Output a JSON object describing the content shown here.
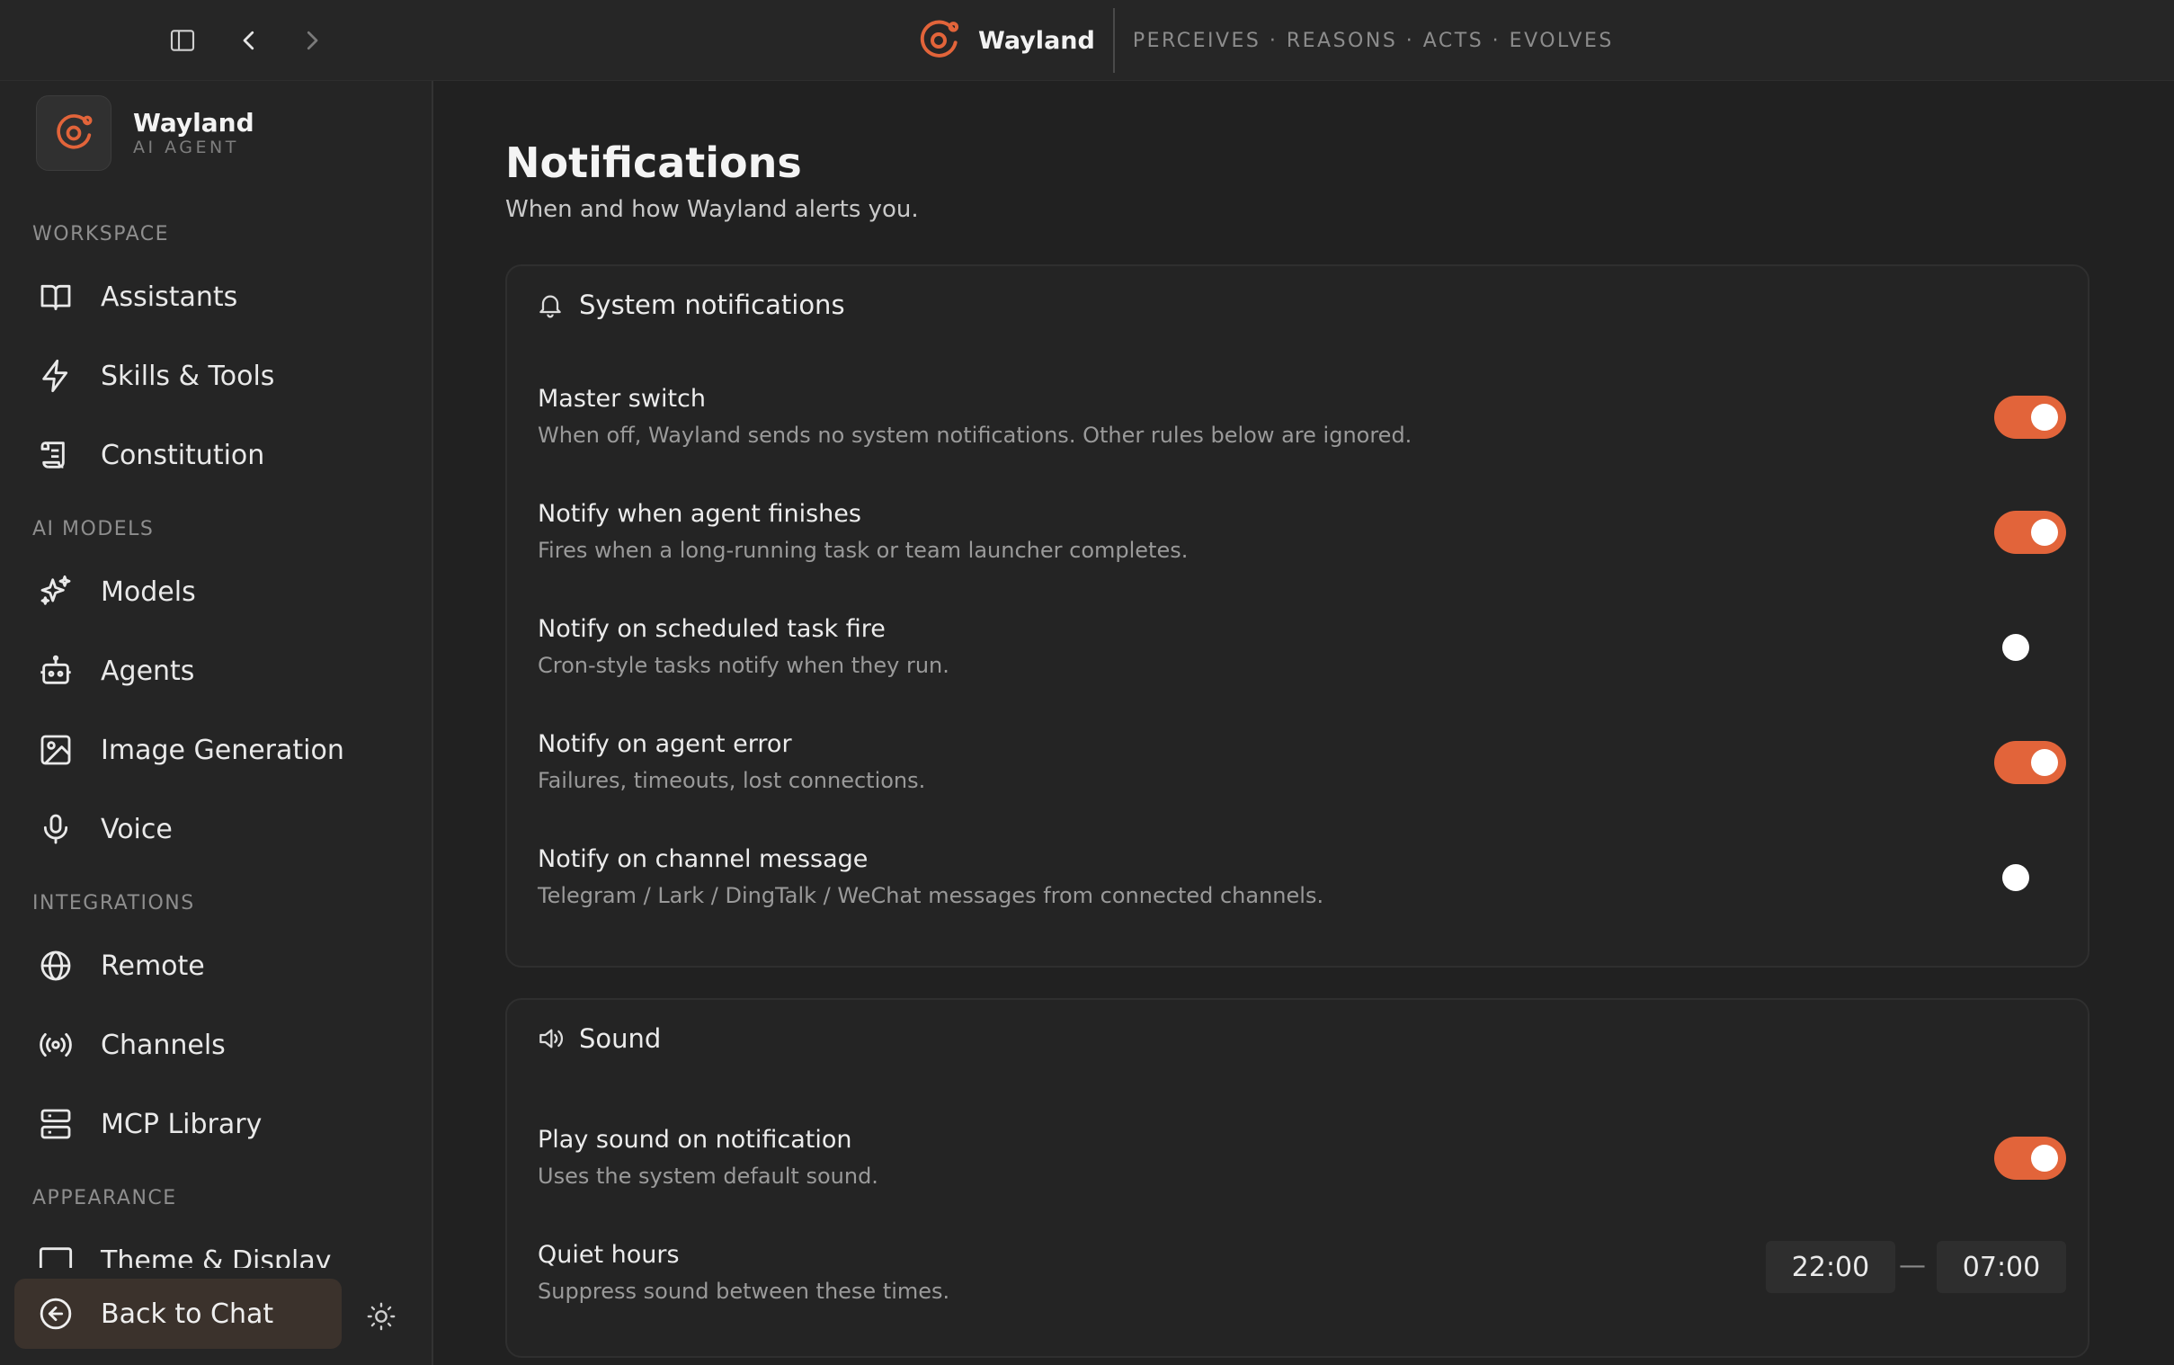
{
  "topbar": {
    "brand_name": "Wayland",
    "tagline": "PERCEIVES · REASONS · ACTS · EVOLVES"
  },
  "sidebar": {
    "app_name": "Wayland",
    "app_sub": "AI AGENT",
    "sections": {
      "workspace": "WORKSPACE",
      "ai_models": "AI MODELS",
      "integrations": "INTEGRATIONS",
      "appearance": "APPEARANCE"
    },
    "items": [
      {
        "label": "Assistants",
        "icon": "book-icon"
      },
      {
        "label": "Skills & Tools",
        "icon": "lightning-icon"
      },
      {
        "label": "Constitution",
        "icon": "scroll-icon"
      },
      {
        "label": "Models",
        "icon": "sparkles-icon"
      },
      {
        "label": "Agents",
        "icon": "robot-icon"
      },
      {
        "label": "Image Generation",
        "icon": "image-icon"
      },
      {
        "label": "Voice",
        "icon": "microphone-icon"
      },
      {
        "label": "Remote",
        "icon": "globe-icon"
      },
      {
        "label": "Channels",
        "icon": "broadcast-icon"
      },
      {
        "label": "MCP Library",
        "icon": "server-icon"
      },
      {
        "label": "Theme & Display",
        "icon": "monitor-icon"
      }
    ],
    "back_label": "Back to Chat"
  },
  "main": {
    "title": "Notifications",
    "subtitle": "When and how Wayland alerts you.",
    "system": {
      "heading": "System notifications",
      "rows": [
        {
          "title": "Master switch",
          "desc": "When off, Wayland sends no system notifications. Other rules below are ignored.",
          "on": true
        },
        {
          "title": "Notify when agent finishes",
          "desc": "Fires when a long-running task or team launcher completes.",
          "on": true
        },
        {
          "title": "Notify on scheduled task fire",
          "desc": "Cron-style tasks notify when they run.",
          "on": false
        },
        {
          "title": "Notify on agent error",
          "desc": "Failures, timeouts, lost connections.",
          "on": true
        },
        {
          "title": "Notify on channel message",
          "desc": "Telegram / Lark / DingTalk / WeChat messages from connected channels.",
          "on": false
        }
      ]
    },
    "sound": {
      "heading": "Sound",
      "play": {
        "title": "Play sound on notification",
        "desc": "Uses the system default sound.",
        "on": true
      },
      "quiet": {
        "title": "Quiet hours",
        "desc": "Suppress sound between these times.",
        "start": "22:00",
        "end": "07:00",
        "separator": "—"
      }
    }
  },
  "colors": {
    "accent": "#e2643a",
    "background": "#212121",
    "sidebar": "#252525"
  }
}
